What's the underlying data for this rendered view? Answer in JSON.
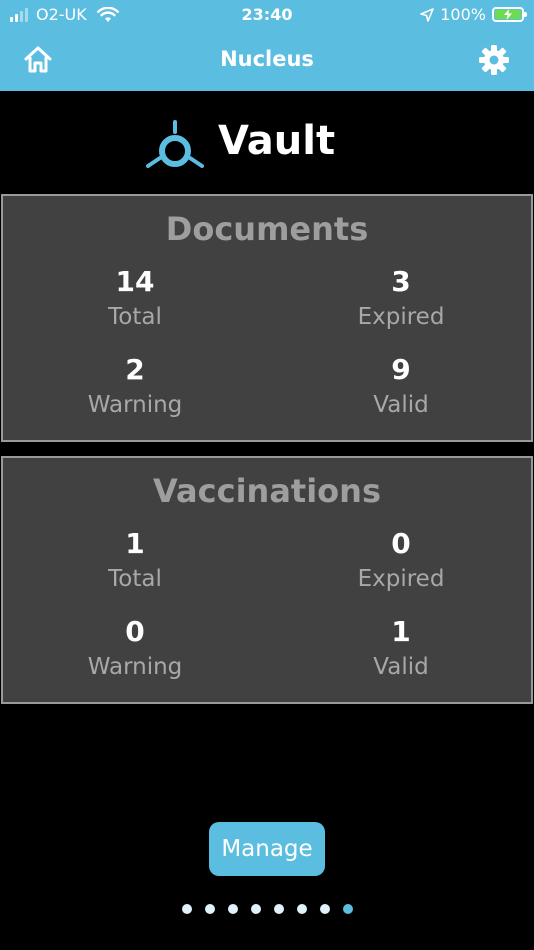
{
  "status_bar": {
    "carrier": "O2-UK",
    "time": "23:40",
    "battery": "100%"
  },
  "navbar": {
    "title": "Nucleus",
    "home_icon": "home-icon",
    "settings_icon": "gear-icon"
  },
  "brand": {
    "title": "Vault",
    "logo_icon": "vault-logo-icon"
  },
  "documents": {
    "title": "Documents",
    "total": {
      "value": "14",
      "label": "Total"
    },
    "expired": {
      "value": "3",
      "label": "Expired"
    },
    "warning": {
      "value": "2",
      "label": "Warning"
    },
    "valid": {
      "value": "9",
      "label": "Valid"
    }
  },
  "vaccinations": {
    "title": "Vaccinations",
    "total": {
      "value": "1",
      "label": "Total"
    },
    "expired": {
      "value": "0",
      "label": "Expired"
    },
    "warning": {
      "value": "0",
      "label": "Warning"
    },
    "valid": {
      "value": "1",
      "label": "Valid"
    }
  },
  "manage_button": {
    "label": "Manage"
  },
  "pager": {
    "count": 8,
    "active_index": 7
  },
  "colors": {
    "accent": "#5bbde0",
    "card_bg": "#414141",
    "card_border": "#9a9a9a",
    "label_gray": "#a8a8a8",
    "battery_green": "#6ddc4e"
  }
}
